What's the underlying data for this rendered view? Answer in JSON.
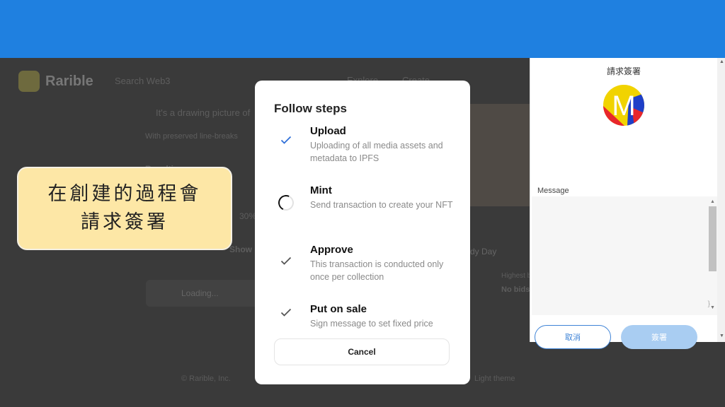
{
  "background_page": {
    "logo_text": "Rarible",
    "search_placeholder": "Search Web3",
    "nav": [
      "Explore",
      "Create"
    ],
    "description": "It's a drawing picture of",
    "line_breaks": "With preserved line-breaks",
    "properties": "Royalties",
    "royalty_percent": "30%",
    "show_more": "Show more",
    "loading": "Loading...",
    "item_name": "dy Day",
    "highest_bid_label": "Highest bid",
    "no_bids": "No bids",
    "copyright": "© Rarible, Inc.",
    "theme": "Light theme"
  },
  "callout": {
    "line1": "在創建的過程會",
    "line2": "請求簽署"
  },
  "modal": {
    "title": "Follow steps",
    "steps": [
      {
        "title": "Upload",
        "description": "Uploading of all media assets and metadata to IPFS",
        "status": "done"
      },
      {
        "title": "Mint",
        "description": "Send transaction to create your NFT",
        "status": "loading"
      },
      {
        "title": "Approve",
        "description": "This transaction is conducted only once per collection",
        "status": "pending"
      },
      {
        "title": "Put on sale",
        "description": "Sign message to set fixed price",
        "status": "pending"
      }
    ],
    "cancel_label": "Cancel"
  },
  "wallet": {
    "title": "請求簽署",
    "avatar_letter": "M",
    "message_label": "Message",
    "message_value": "}",
    "cancel_label": "取消",
    "sign_label": "簽署"
  },
  "colors": {
    "top_band": "#1f80e0",
    "step_done": "#2f6fd8",
    "step_pending": "#555555",
    "callout_bg": "#fde7a6",
    "wallet_accent": "#3e83d6"
  }
}
